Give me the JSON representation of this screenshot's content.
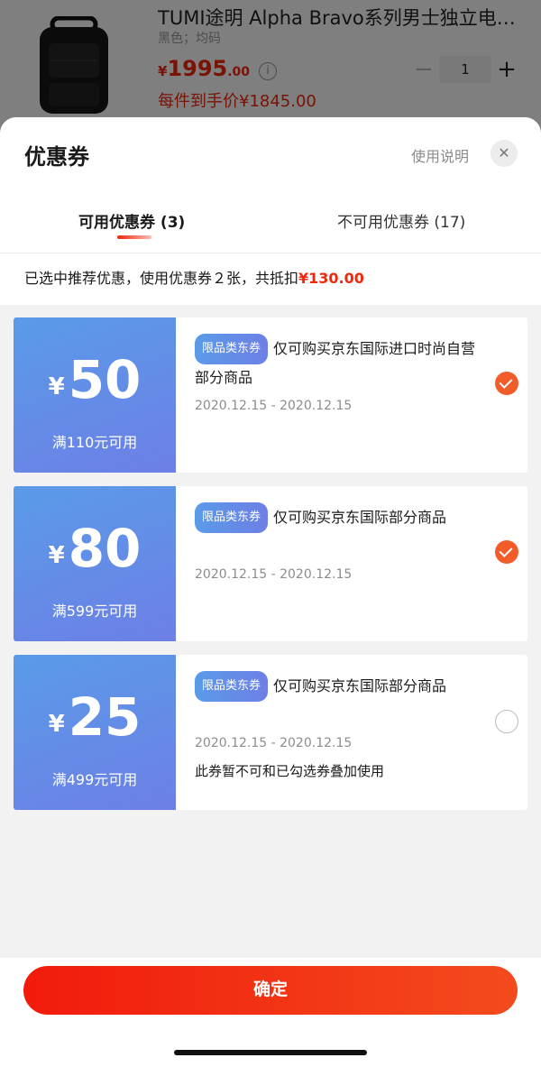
{
  "product": {
    "title": "TUMI途明 Alpha Bravo系列男士独立电脑隔...",
    "spec": "黑色；均码",
    "price_yen": "¥",
    "price_main": "1995",
    "price_decimal": ".00",
    "info_icon": "info-icon",
    "final_price": "每件到手价¥1845.00",
    "quantity": "1",
    "minus_label": "−",
    "plus_label": "+"
  },
  "sheet": {
    "title": "优惠券",
    "usage_link": "使用说明",
    "close_label": "✕",
    "tabs": [
      {
        "label": "可用优惠券 (3)",
        "active": true
      },
      {
        "label": "不可用优惠券 (17)",
        "active": false
      }
    ],
    "summary_prefix": "已选中推荐优惠，使用优惠券２张，共抵扣",
    "summary_amount": "¥130.00"
  },
  "coupons": [
    {
      "yen": "¥",
      "amount": "50",
      "threshold": "满110元可用",
      "tag": "限品类东券",
      "desc": "仅可购买京东国际进口时尚自营部分商品",
      "date": "2020.12.15 - 2020.12.15",
      "note": "",
      "selected": true
    },
    {
      "yen": "¥",
      "amount": "80",
      "threshold": "满599元可用",
      "tag": "限品类东券",
      "desc": "仅可购买京东国际部分商品",
      "date": "2020.12.15 - 2020.12.15",
      "note": "",
      "selected": true
    },
    {
      "yen": "¥",
      "amount": "25",
      "threshold": "满499元可用",
      "tag": "限品类东券",
      "desc": "仅可购买京东国际部分商品",
      "date": "2020.12.15 - 2020.12.15",
      "note": "此券暂不可和已勾选券叠加使用",
      "selected": false
    }
  ],
  "footer": {
    "confirm_label": "确定"
  },
  "colors": {
    "accent_red": "#f2270c",
    "check_orange": "#f25c2a",
    "coupon_blue": "#5a9be8"
  }
}
